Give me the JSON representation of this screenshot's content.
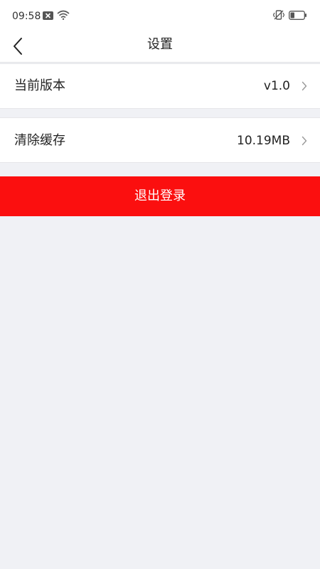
{
  "status_bar": {
    "time": "09:58",
    "icons": [
      "notification-close-icon",
      "wifi-icon",
      "vibrate-icon",
      "battery-icon"
    ]
  },
  "nav": {
    "title": "设置",
    "back_icon": "chevron-left-icon"
  },
  "settings": {
    "items": [
      {
        "label": "当前版本",
        "value": "v1.0",
        "icon": "chevron-right-icon"
      },
      {
        "label": "清除缓存",
        "value": "10.19MB",
        "icon": "chevron-right-icon"
      }
    ]
  },
  "logout": {
    "label": "退出登录"
  },
  "colors": {
    "logout_bg": "#fb0f0f",
    "page_bg": "#f0f1f5",
    "row_bg": "#ffffff"
  }
}
